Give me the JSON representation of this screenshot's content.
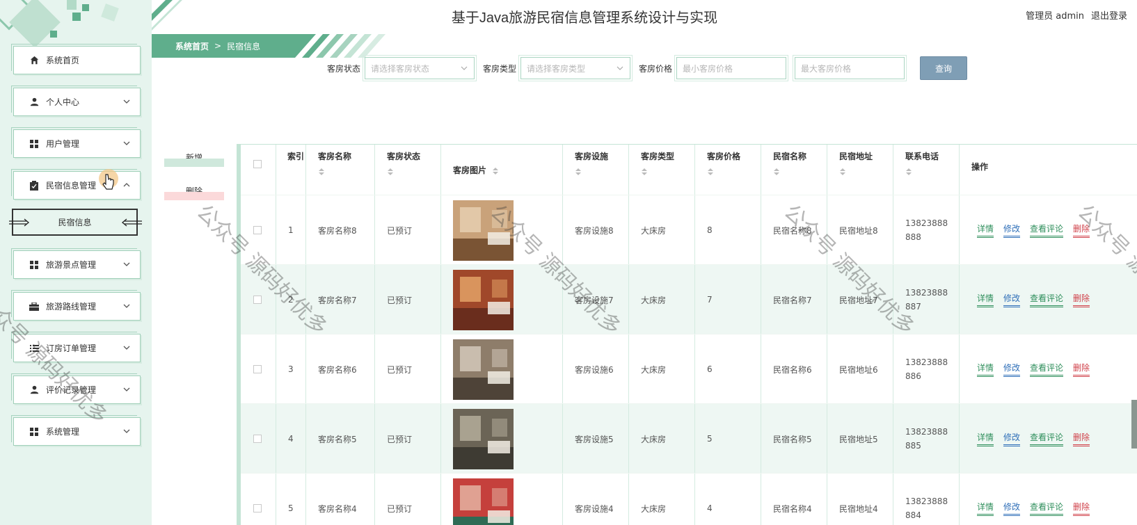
{
  "app": {
    "title": "基于Java旅游民宿信息管理系统设计与实现",
    "user_label": "管理员 admin",
    "logout": "退出登录"
  },
  "sidebar": {
    "items": [
      {
        "label": "系统首页",
        "icon": "home-icon",
        "expandable": false
      },
      {
        "label": "个人中心",
        "icon": "person-icon",
        "expandable": true
      },
      {
        "label": "用户管理",
        "icon": "grid-icon",
        "expandable": true
      },
      {
        "label": "民宿信息管理",
        "icon": "clipboard-icon",
        "expandable": true,
        "expanded": true
      },
      {
        "label": "旅游景点管理",
        "icon": "grid-icon",
        "expandable": true
      },
      {
        "label": "旅游路线管理",
        "icon": "briefcase-icon",
        "expandable": true
      },
      {
        "label": "订房订单管理",
        "icon": "list-icon",
        "expandable": true
      },
      {
        "label": "评价记录管理",
        "icon": "user-icon",
        "expandable": true
      },
      {
        "label": "系统管理",
        "icon": "grid-icon",
        "expandable": true
      }
    ],
    "subitem": "民宿信息"
  },
  "breadcrumb": {
    "home": "系统首页",
    "sep": ">",
    "current": "民宿信息"
  },
  "search": {
    "status_label": "客房状态",
    "status_placeholder": "请选择客房状态",
    "type_label": "客房类型",
    "type_placeholder": "请选择客房类型",
    "price_label": "客房价格",
    "min_price_placeholder": "最小客房价格",
    "max_price_placeholder": "最大客房价格",
    "query_button": "查询"
  },
  "actions": {
    "add": "新增",
    "delete": "删除"
  },
  "table": {
    "columns": {
      "index": "索引",
      "room_name": "客房名称",
      "room_status": "客房状态",
      "room_image": "客房图片",
      "facilities": "客房设施",
      "room_type": "客房类型",
      "price": "客房价格",
      "homestay_name": "民宿名称",
      "address": "民宿地址",
      "phone": "联系电话",
      "ops": "操作"
    },
    "op_labels": {
      "detail": "详情",
      "edit": "修改",
      "comments": "查看评论",
      "delete": "删除"
    },
    "rows": [
      {
        "index": "1",
        "room_name": "客房名称8",
        "room_status": "已预订",
        "facilities": "客房设施8",
        "room_type": "大床房",
        "price": "8",
        "homestay_name": "民宿名称8",
        "address": "民宿地址8",
        "phone_a": "13823888",
        "phone_b": "888"
      },
      {
        "index": "2",
        "room_name": "客房名称7",
        "room_status": "已预订",
        "facilities": "客房设施7",
        "room_type": "大床房",
        "price": "7",
        "homestay_name": "民宿名称7",
        "address": "民宿地址7",
        "phone_a": "13823888",
        "phone_b": "887"
      },
      {
        "index": "3",
        "room_name": "客房名称6",
        "room_status": "已预订",
        "facilities": "客房设施6",
        "room_type": "大床房",
        "price": "6",
        "homestay_name": "民宿名称6",
        "address": "民宿地址6",
        "phone_a": "13823888",
        "phone_b": "886"
      },
      {
        "index": "4",
        "room_name": "客房名称5",
        "room_status": "已预订",
        "facilities": "客房设施5",
        "room_type": "大床房",
        "price": "5",
        "homestay_name": "民宿名称5",
        "address": "民宿地址5",
        "phone_a": "13823888",
        "phone_b": "885"
      },
      {
        "index": "5",
        "room_name": "客房名称4",
        "room_status": "已预订",
        "facilities": "客房设施4",
        "room_type": "大床房",
        "price": "4",
        "homestay_name": "民宿名称4",
        "address": "民宿地址4",
        "phone_a": "13823888",
        "phone_b": "884"
      }
    ]
  },
  "watermark": "公众号 源码好优多",
  "colors": {
    "accent": "#5fae8c",
    "sidebar_bg": "#e6f4ee",
    "query_button": "#7f9eb5",
    "delete_link": "#d0414a",
    "edit_link": "#2f6fb8",
    "detail_link": "#2f8f5c"
  }
}
